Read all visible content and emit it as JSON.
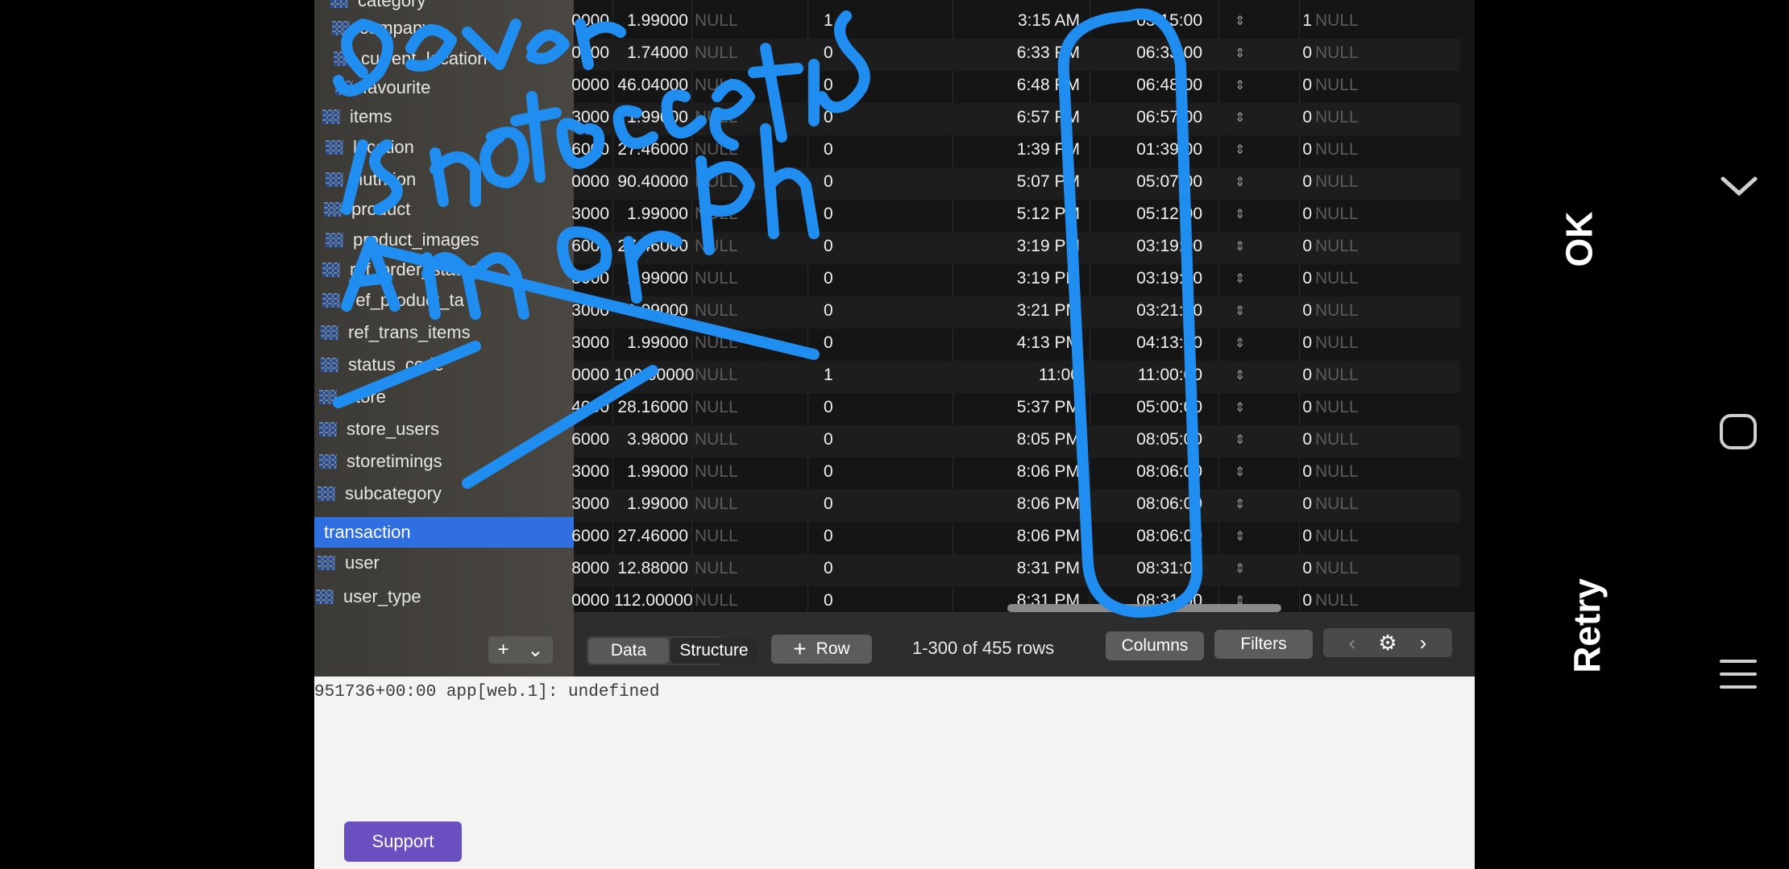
{
  "sidebar": {
    "items": [
      {
        "label": "category"
      },
      {
        "label": "company"
      },
      {
        "label": "current_location"
      },
      {
        "label": "favourite"
      },
      {
        "label": "items"
      },
      {
        "label": "location"
      },
      {
        "label": "nutrition"
      },
      {
        "label": "product"
      },
      {
        "label": "product_images"
      },
      {
        "label": "ref_order_status"
      },
      {
        "label": "ref_product_ta"
      },
      {
        "label": "ref_trans_items"
      },
      {
        "label": "status_code"
      },
      {
        "label": "store"
      },
      {
        "label": "store_users"
      },
      {
        "label": "storetimings"
      },
      {
        "label": "subcategory"
      },
      {
        "label": "transaction",
        "selected": true
      },
      {
        "label": "user"
      },
      {
        "label": "user_type"
      }
    ],
    "add_label": "+",
    "menu_label": "⌄"
  },
  "table": {
    "rows": [
      {
        "c1": "0000",
        "c2": "1.99000",
        "c3": "NULL",
        "c4": "1",
        "c5": "3:15 AM",
        "c6": "03:15:00",
        "c7": "1",
        "c8": "NULL"
      },
      {
        "c1": "0000",
        "c2": "1.74000",
        "c3": "NULL",
        "c4": "0",
        "c5": "6:33 PM",
        "c6": "06:33:00",
        "c7": "0",
        "c8": "NULL"
      },
      {
        "c1": "0000",
        "c2": "46.04000",
        "c3": "NULL",
        "c4": "0",
        "c5": "6:48 PM",
        "c6": "06:48:00",
        "c7": "0",
        "c8": "NULL"
      },
      {
        "c1": "3000",
        "c2": "1.99000",
        "c3": "NULL",
        "c4": "0",
        "c5": "6:57 PM",
        "c6": "06:57:00",
        "c7": "0",
        "c8": "NULL"
      },
      {
        "c1": "6000",
        "c2": "27.46000",
        "c3": "NULL",
        "c4": "0",
        "c5": "1:39 PM",
        "c6": "01:39:00",
        "c7": "0",
        "c8": "NULL"
      },
      {
        "c1": "0000",
        "c2": "90.40000",
        "c3": "NULL",
        "c4": "0",
        "c5": "5:07 PM",
        "c6": "05:07:00",
        "c7": "0",
        "c8": "NULL"
      },
      {
        "c1": "3000",
        "c2": "1.99000",
        "c3": "NULL",
        "c4": "0",
        "c5": "5:12 PM",
        "c6": "05:12:00",
        "c7": "0",
        "c8": "NULL"
      },
      {
        "c1": "6000",
        "c2": "27.46000",
        "c3": "NULL",
        "c4": "0",
        "c5": "3:19 PM",
        "c6": "03:19:00",
        "c7": "0",
        "c8": "NULL"
      },
      {
        "c1": "3000",
        "c2": "1.99000",
        "c3": "NULL",
        "c4": "0",
        "c5": "3:19 PM",
        "c6": "03:19:00",
        "c7": "0",
        "c8": "NULL"
      },
      {
        "c1": "3000",
        "c2": "1.99000",
        "c3": "NULL",
        "c4": "0",
        "c5": "3:21 PM",
        "c6": "03:21:00",
        "c7": "0",
        "c8": "NULL"
      },
      {
        "c1": "3000",
        "c2": "1.99000",
        "c3": "NULL",
        "c4": "0",
        "c5": "4:13 PM",
        "c6": "04:13:00",
        "c7": "0",
        "c8": "NULL"
      },
      {
        "c1": "0000",
        "c2": "100.00000",
        "c3": "NULL",
        "c4": "1",
        "c5": "11:00",
        "c6": "11:00:00",
        "c7": "0",
        "c8": "NULL"
      },
      {
        "c1": "4000",
        "c2": "28.16000",
        "c3": "NULL",
        "c4": "0",
        "c5": "5:37 PM",
        "c6": "05:00:00",
        "c7": "0",
        "c8": "NULL"
      },
      {
        "c1": "6000",
        "c2": "3.98000",
        "c3": "NULL",
        "c4": "0",
        "c5": "8:05 PM",
        "c6": "08:05:00",
        "c7": "0",
        "c8": "NULL"
      },
      {
        "c1": "3000",
        "c2": "1.99000",
        "c3": "NULL",
        "c4": "0",
        "c5": "8:06 PM",
        "c6": "08:06:00",
        "c7": "0",
        "c8": "NULL"
      },
      {
        "c1": "3000",
        "c2": "1.99000",
        "c3": "NULL",
        "c4": "0",
        "c5": "8:06 PM",
        "c6": "08:06:00",
        "c7": "0",
        "c8": "NULL"
      },
      {
        "c1": "6000",
        "c2": "27.46000",
        "c3": "NULL",
        "c4": "0",
        "c5": "8:06 PM",
        "c6": "08:06:00",
        "c7": "0",
        "c8": "NULL"
      },
      {
        "c1": "8000",
        "c2": "12.88000",
        "c3": "NULL",
        "c4": "0",
        "c5": "8:31 PM",
        "c6": "08:31:00",
        "c7": "0",
        "c8": "NULL"
      },
      {
        "c1": "0000",
        "c2": "112.00000",
        "c3": "NULL",
        "c4": "0",
        "c5": "8:31 PM",
        "c6": "08:31:00",
        "c7": "0",
        "c8": "NULL"
      }
    ]
  },
  "toolbar": {
    "data_tab": "Data",
    "structure_tab": "Structure",
    "add_row_label": "Row",
    "rows_count": "1-300 of 455 rows",
    "columns_label": "Columns",
    "filters_label": "Filters"
  },
  "log": {
    "line": "951736+00:00 app[web.1]: undefined",
    "support_label": "Support"
  },
  "camera": {
    "ok_label": "OK",
    "retry_label": "Retry"
  },
  "colors": {
    "annotation": "#1f8ef0",
    "selection": "#2f6fe0",
    "support": "#6a4fc0"
  }
}
